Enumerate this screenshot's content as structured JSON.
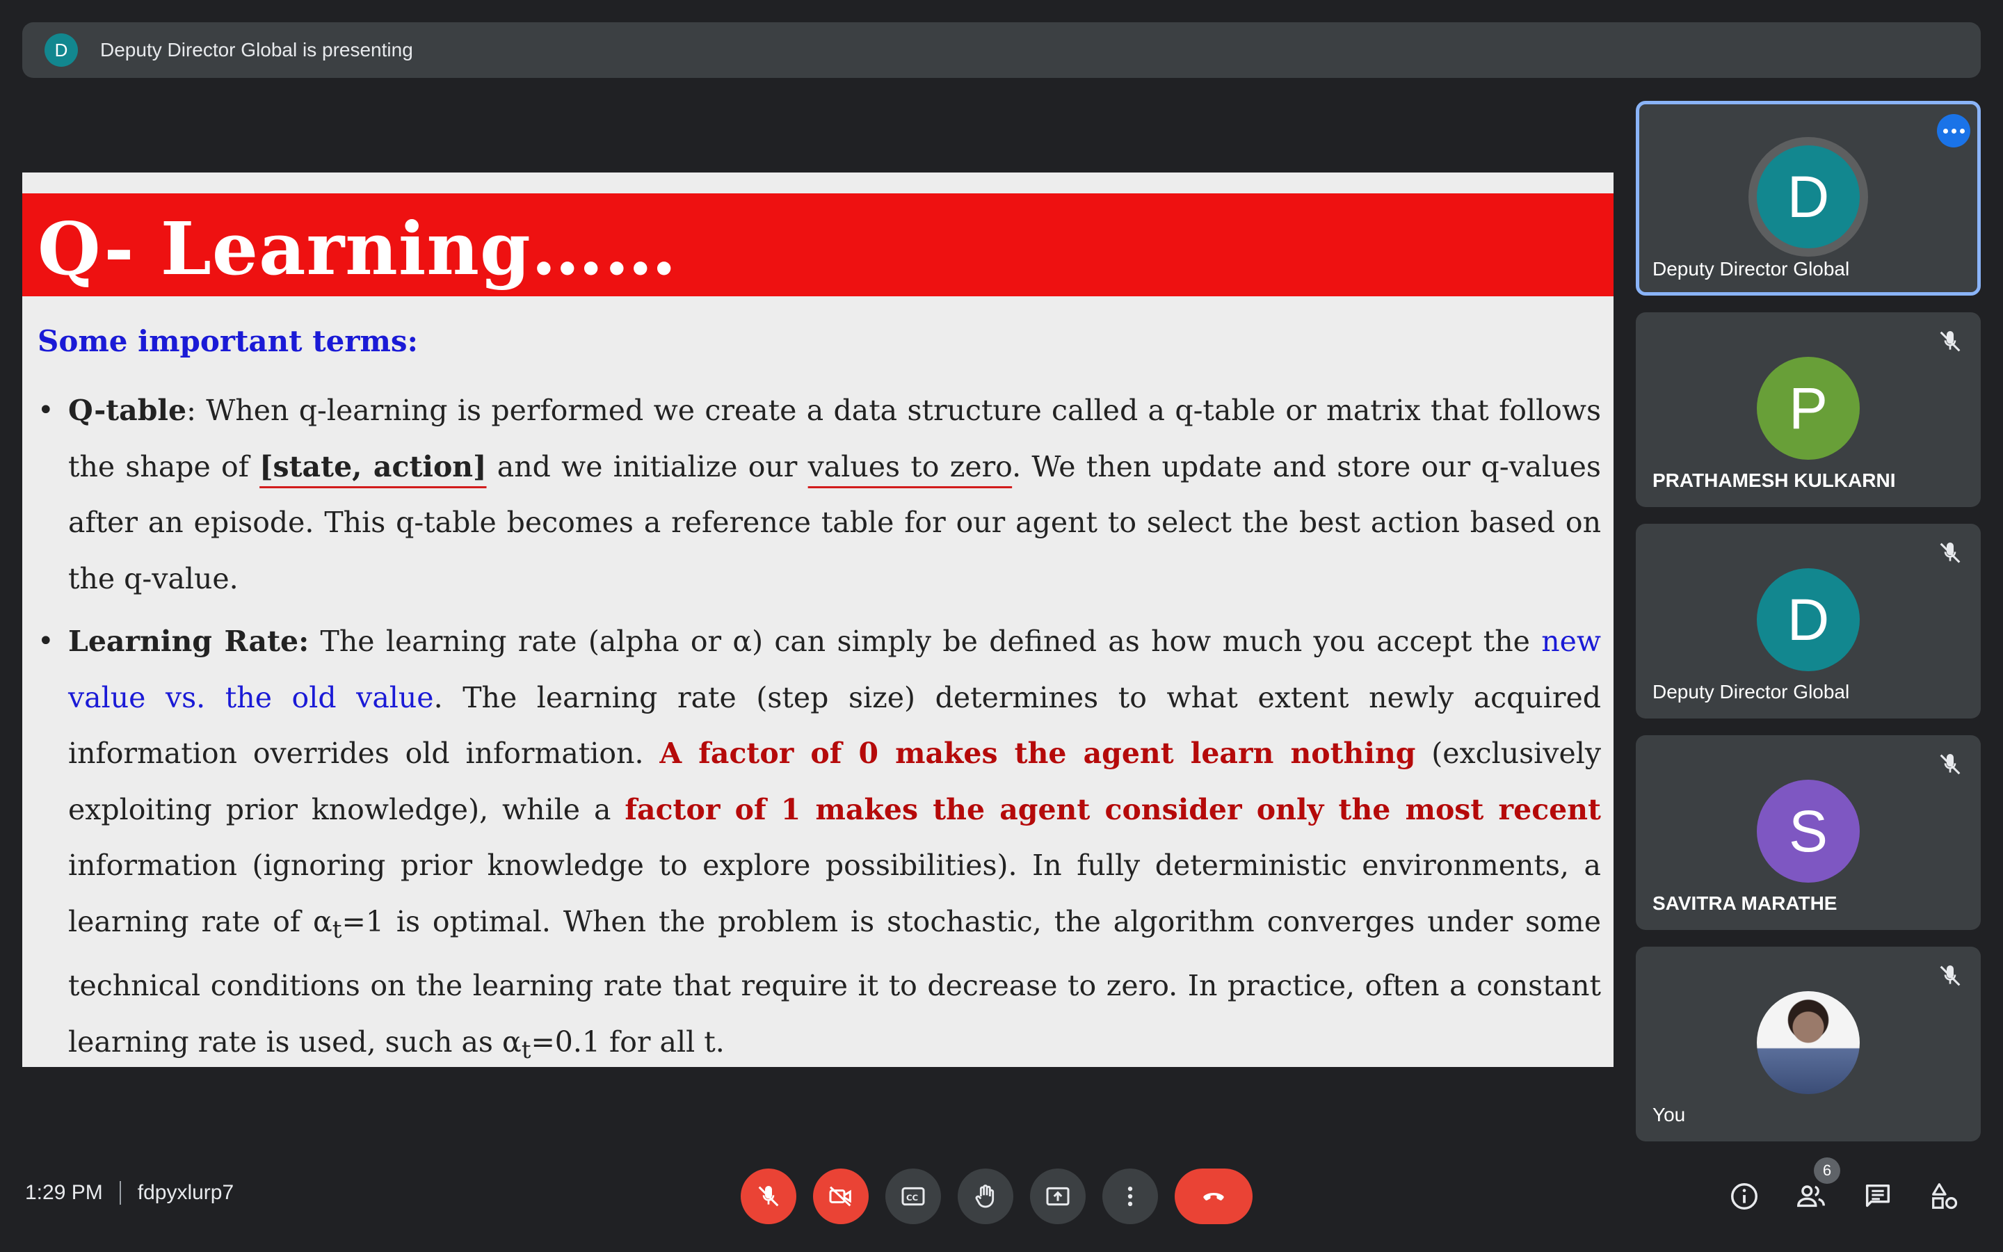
{
  "banner": {
    "avatar_letter": "D",
    "text": "Deputy Director Global is presenting"
  },
  "slide": {
    "title": "Q- Learning……",
    "subtitle": "Some important terms:",
    "q_table": {
      "term": "Q-table",
      "text_1": ": When q-learning is performed we create a data structure called a q-table or matrix that follows the shape of ",
      "state_action": "[state, action]",
      "text_2": " and we initialize our ",
      "values_to_zero": "values to zero",
      "text_3": ". We then update and store our q-values after an episode. This q-table becomes a reference table for our agent to select the best action based on the q-value."
    },
    "learning_rate": {
      "term": "Learning Rate:",
      "text_1": " The learning rate (alpha or α) can simply be defined as how much you accept the ",
      "blue_text": "new value vs. the old value",
      "text_2": ". The learning rate (step size) determines to what extent newly acquired information overrides old information. ",
      "red_1": "A factor of 0 makes the agent learn nothing",
      "text_3": " (exclusively exploiting prior knowledge), while a ",
      "red_2": "factor of 1 makes the agent consider only the most recent",
      "text_4": " information (ignoring prior knowledge to explore possibilities). In fully deterministic environments, a learning rate of α",
      "sub_t_1": "t",
      "text_5": "=1 is optimal. When the problem is stochastic, the algorithm converges under some technical conditions on the learning rate that require it to decrease to zero. In practice, often a constant learning rate is used, such as  α",
      "sub_t_2": "t",
      "text_6": "=0.1 for all t."
    }
  },
  "participants": [
    {
      "letter": "D",
      "name": "Deputy Director Global",
      "color": "#12878f"
    },
    {
      "letter": "P",
      "name": "PRATHAMESH KULKARNI",
      "color": "#689f38"
    },
    {
      "letter": "D",
      "name": "Deputy Director Global",
      "color": "#12878f"
    },
    {
      "letter": "S",
      "name": "SAVITRA MARATHE",
      "color": "#7e57c2"
    },
    {
      "name": "You"
    }
  ],
  "footer": {
    "time": "1:29 PM",
    "meeting_code": "fdpyxlurp7",
    "people_count": "6"
  },
  "colors": {
    "accent": "#8ab4f8",
    "danger": "#ea4335",
    "tile_bg": "#3c4043",
    "bg": "#202124"
  }
}
